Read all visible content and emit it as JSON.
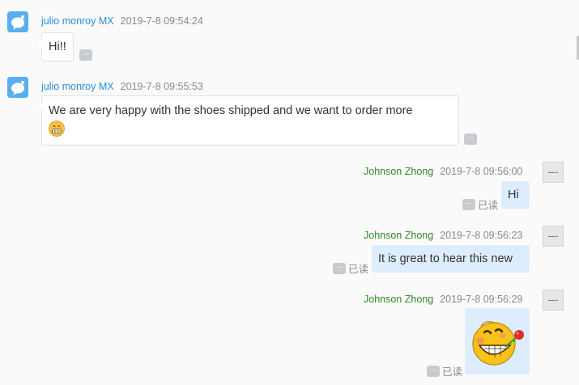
{
  "messages": [
    {
      "sender": "julio monroy MX",
      "time": "2019-7-8 09:54:24",
      "text": "Hi!!"
    },
    {
      "sender": "julio monroy MX",
      "time": "2019-7-8 09:55:53",
      "text": "We are very happy with the shoes shipped and we want to order more",
      "emoji": "grinning-face-emoji"
    },
    {
      "sender": "Johnson Zhong",
      "time": "2019-7-8 09:56:00",
      "text": "Hi",
      "status": "已读"
    },
    {
      "sender": "Johnson Zhong",
      "time": "2019-7-8 09:56:23",
      "text": "It is great to hear this new",
      "status": "已读"
    },
    {
      "sender": "Johnson Zhong",
      "time": "2019-7-8 09:56:29",
      "sticker": "grinning-rose-sticker",
      "status": "已读"
    }
  ],
  "more_label": "···",
  "colors": {
    "left_name": "#2b8fd3",
    "right_name": "#2e8b24",
    "right_bubble": "#deedfd",
    "left_bubble": "#ffffff",
    "avatar_left": "#5aaef0"
  },
  "icons": {
    "left_avatar": "chat-bubble-avatar-icon",
    "right_avatar": "company-logo-avatar",
    "more": "more-options-icon"
  }
}
